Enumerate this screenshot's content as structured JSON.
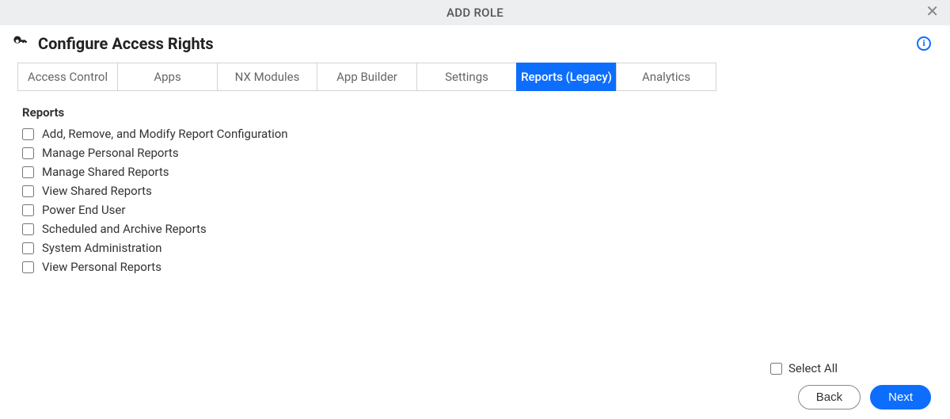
{
  "header": {
    "title": "ADD ROLE"
  },
  "section": {
    "title": "Configure Access Rights"
  },
  "tabs": [
    {
      "label": "Access Control",
      "active": false
    },
    {
      "label": "Apps",
      "active": false
    },
    {
      "label": "NX Modules",
      "active": false
    },
    {
      "label": "App Builder",
      "active": false
    },
    {
      "label": "Settings",
      "active": false
    },
    {
      "label": "Reports (Legacy)",
      "active": true
    },
    {
      "label": "Analytics",
      "active": false
    }
  ],
  "group": {
    "title": "Reports"
  },
  "permissions": [
    {
      "label": "Add, Remove, and Modify Report Configuration",
      "checked": false
    },
    {
      "label": "Manage Personal Reports",
      "checked": false
    },
    {
      "label": "Manage Shared Reports",
      "checked": false
    },
    {
      "label": "View Shared Reports",
      "checked": false
    },
    {
      "label": "Power End User",
      "checked": false
    },
    {
      "label": "Scheduled and Archive Reports",
      "checked": false
    },
    {
      "label": "System Administration",
      "checked": false
    },
    {
      "label": "View Personal Reports",
      "checked": false
    }
  ],
  "footer": {
    "select_all_label": "Select All",
    "select_all_checked": false,
    "back_label": "Back",
    "next_label": "Next"
  }
}
